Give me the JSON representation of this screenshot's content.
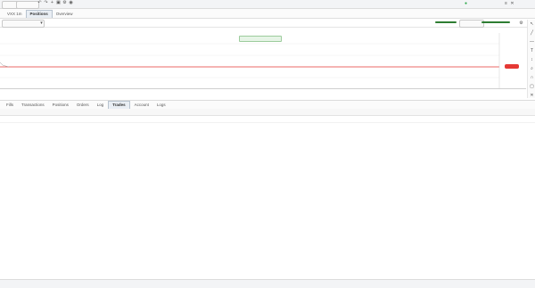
{
  "toolbar": {
    "symbol_button": "",
    "secondary_button": "",
    "tabs": [
      {
        "label": "VXX 1m"
      },
      {
        "label": "Positions"
      },
      {
        "label": "Overview"
      }
    ],
    "right_label": ""
  },
  "subbar": {
    "dropdown_value": "",
    "right_select_value": "",
    "mid_text": ""
  },
  "chart": {
    "legend_label": "",
    "center_badge": "",
    "right_badge": "",
    "x_ticks": [
      "",
      "",
      "",
      "",
      "",
      "",
      "",
      "",
      "",
      "",
      "",
      "",
      "",
      ""
    ],
    "y_ticks": [
      "",
      "",
      "",
      ""
    ]
  },
  "panel": {
    "tabs": [
      {
        "label": "Fills"
      },
      {
        "label": "Transactions"
      },
      {
        "label": "Positions"
      },
      {
        "label": "Orders"
      },
      {
        "label": "Log"
      },
      {
        "label": "Trades"
      },
      {
        "label": "Account"
      },
      {
        "label": "Logs"
      }
    ],
    "columns": [
      "",
      "",
      "",
      "",
      "",
      "",
      "",
      "",
      "",
      "",
      "",
      ""
    ]
  },
  "table": {
    "rows": [
      [
        "",
        "",
        "",
        "",
        "",
        "",
        "",
        "",
        "",
        "",
        "",
        ""
      ]
    ]
  },
  "status": {
    "left": "",
    "right": ""
  },
  "colors": {
    "accent": "#2e7d32",
    "price_line": "#e53935",
    "positive": "#2ea84a",
    "negative": "#d9534f"
  }
}
